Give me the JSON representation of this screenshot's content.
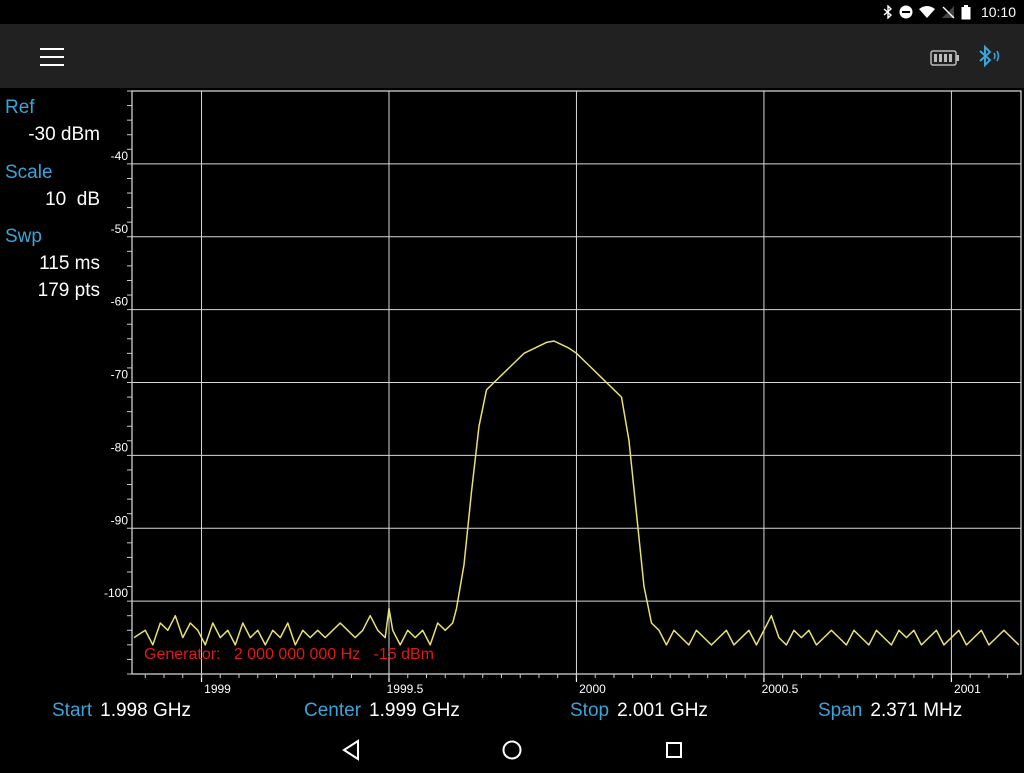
{
  "status_bar": {
    "time": "10:10",
    "icons": [
      "bluetooth-icon",
      "do-not-disturb-icon",
      "wifi-icon",
      "no-signal-icon",
      "battery-icon"
    ]
  },
  "app_bar": {
    "menu_icon": "hamburger-menu-icon",
    "title": "",
    "battery_icon": "device-battery-icon",
    "bluetooth_icon": "bluetooth-connected-icon",
    "accent_color": "#3aa4d8"
  },
  "settings": {
    "ref_label": "Ref",
    "ref_value": "-30 dBm",
    "scale_label": "Scale",
    "scale_value": "10  dB",
    "swp_label": "Swp",
    "swp_time": "115 ms",
    "swp_points": "179 pts"
  },
  "generator": {
    "label": "Generator:",
    "frequency": "2 000 000 000 Hz",
    "level": "-15 dBm",
    "color": "#e01818"
  },
  "frequency_bar": {
    "start_label": "Start",
    "start_value": "1.998 GHz",
    "center_label": "Center",
    "center_value": "1.999 GHz",
    "stop_label": "Stop",
    "stop_value": "2.001 GHz",
    "span_label": "Span",
    "span_value": "2.371 MHz"
  },
  "nav": {
    "back_icon": "back-triangle-icon",
    "home_icon": "home-circle-icon",
    "recents_icon": "recents-square-icon"
  },
  "chart_data": {
    "type": "line",
    "title": "",
    "xlabel": "",
    "ylabel": "",
    "xlim": [
      1998.8146,
      2001.1856
    ],
    "ylim": [
      -110,
      -30
    ],
    "x_ticks": [
      1999,
      1999.5,
      2000,
      2000.5,
      2001
    ],
    "x_tick_labels": [
      "1999",
      "1999.5",
      "2000",
      "2000.5",
      "2001"
    ],
    "y_ticks": [
      -40,
      -50,
      -60,
      -70,
      -80,
      -90,
      -100
    ],
    "y_tick_labels": [
      "-40",
      "-50",
      "-60",
      "-70",
      "-80",
      "-90",
      "-100"
    ],
    "grid": true,
    "trace_color": "#e8e070",
    "series": [
      {
        "x": [
          1998.82,
          1998.85,
          1998.87,
          1998.89,
          1998.91,
          1998.93,
          1998.95,
          1998.97,
          1998.99,
          1999.01,
          1999.03,
          1999.05,
          1999.07,
          1999.09,
          1999.11,
          1999.13,
          1999.15,
          1999.17,
          1999.19,
          1999.21,
          1999.23,
          1999.25,
          1999.27,
          1999.29,
          1999.31,
          1999.33,
          1999.35,
          1999.37,
          1999.39,
          1999.41,
          1999.43,
          1999.45,
          1999.47,
          1999.49,
          1999.5,
          1999.51,
          1999.53,
          1999.55,
          1999.57,
          1999.59,
          1999.61,
          1999.63,
          1999.65,
          1999.67,
          1999.68,
          1999.7,
          1999.72,
          1999.74,
          1999.76,
          1999.78,
          1999.8,
          1999.82,
          1999.84,
          1999.86,
          1999.88,
          1999.9,
          1999.92,
          1999.94,
          1999.96,
          1999.98,
          2000.0,
          2000.02,
          2000.04,
          2000.06,
          2000.08,
          2000.1,
          2000.12,
          2000.14,
          2000.16,
          2000.18,
          2000.2,
          2000.22,
          2000.24,
          2000.26,
          2000.28,
          2000.3,
          2000.32,
          2000.34,
          2000.36,
          2000.38,
          2000.4,
          2000.42,
          2000.44,
          2000.46,
          2000.48,
          2000.5,
          2000.52,
          2000.54,
          2000.56,
          2000.58,
          2000.6,
          2000.62,
          2000.64,
          2000.66,
          2000.68,
          2000.7,
          2000.72,
          2000.74,
          2000.76,
          2000.78,
          2000.8,
          2000.82,
          2000.84,
          2000.86,
          2000.88,
          2000.9,
          2000.92,
          2000.94,
          2000.96,
          2000.98,
          2001.0,
          2001.02,
          2001.04,
          2001.06,
          2001.08,
          2001.1,
          2001.12,
          2001.14,
          2001.16,
          2001.18
        ],
        "y": [
          -105,
          -104,
          -106,
          -103,
          -104,
          -102,
          -105,
          -103,
          -104,
          -106,
          -103,
          -105,
          -104,
          -106,
          -103,
          -105,
          -104,
          -106,
          -104,
          -105,
          -103,
          -106,
          -104,
          -105,
          -104,
          -105,
          -104,
          -103,
          -104,
          -105,
          -104,
          -102,
          -104,
          -105,
          -101,
          -104,
          -106,
          -104,
          -105,
          -104,
          -106,
          -103,
          -104,
          -103,
          -101,
          -95,
          -85,
          -76,
          -71,
          -70,
          -69,
          -68,
          -67,
          -66,
          -65.5,
          -65,
          -64.5,
          -64.3,
          -64.8,
          -65.3,
          -66,
          -67,
          -68,
          -69,
          -70,
          -71,
          -72,
          -78,
          -88,
          -98,
          -103,
          -104,
          -106,
          -104,
          -105,
          -106,
          -104,
          -105,
          -106,
          -105,
          -104,
          -106,
          -105,
          -104,
          -106,
          -104,
          -102,
          -105,
          -106,
          -104,
          -105,
          -104,
          -106,
          -105,
          -104,
          -105,
          -106,
          -104,
          -105,
          -106,
          -104,
          -105,
          -106,
          -104,
          -105,
          -104,
          -106,
          -105,
          -104,
          -106,
          -105,
          -104,
          -106,
          -105,
          -104,
          -106,
          -105,
          -104,
          -105,
          -106
        ]
      }
    ]
  }
}
